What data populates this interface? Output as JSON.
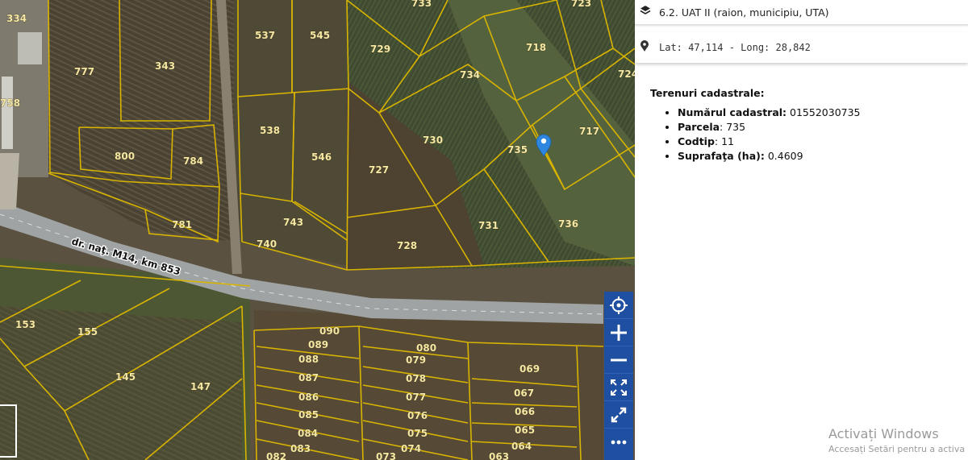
{
  "map": {
    "road_label": "dr. naţ. M14, km 853",
    "parcels": [
      "334",
      "537",
      "545",
      "733",
      "718",
      "723",
      "343",
      "777",
      "729",
      "734",
      "724",
      "758",
      "538",
      "546",
      "730",
      "735",
      "717",
      "800",
      "784",
      "727",
      "781",
      "743",
      "740",
      "728",
      "731",
      "736",
      "153",
      "155",
      "090",
      "089",
      "080",
      "088",
      "079",
      "145",
      "087",
      "078",
      "069",
      "147",
      "086",
      "077",
      "067",
      "085",
      "076",
      "066",
      "084",
      "075",
      "065",
      "083",
      "074",
      "064",
      "082",
      "073",
      "063"
    ],
    "marker_icon": "map-marker-icon"
  },
  "controls": {
    "locate_icon": "crosshair-icon",
    "zoom_in_icon": "plus-icon",
    "zoom_out_icon": "minus-icon",
    "extent_icon": "expand-icon",
    "fullscreen_icon": "fullscreen-icon",
    "more_icon": "more-icon"
  },
  "panel": {
    "layer_label": "6.2. UAT II (raion, municipiu, UTA)",
    "coords": "Lat: 47,114 - Long: 28,842",
    "info_title": "Terenuri cadastrale:",
    "fields": [
      {
        "label": "Numărul cadastral:",
        "value": " 01552030735"
      },
      {
        "label": "Parcela",
        "value": ": 735"
      },
      {
        "label": "Codtip",
        "value": ": 11"
      },
      {
        "label": "Suprafaţa (ha):",
        "value": " 0.4609"
      }
    ]
  },
  "watermark": {
    "line1": "Activați Windows",
    "line2": "Accesați Setări pentru a activa W"
  },
  "colors": {
    "parcel_border": "#d8b400",
    "control_bg": "#1f4fa0",
    "marker": "#2e86de"
  }
}
